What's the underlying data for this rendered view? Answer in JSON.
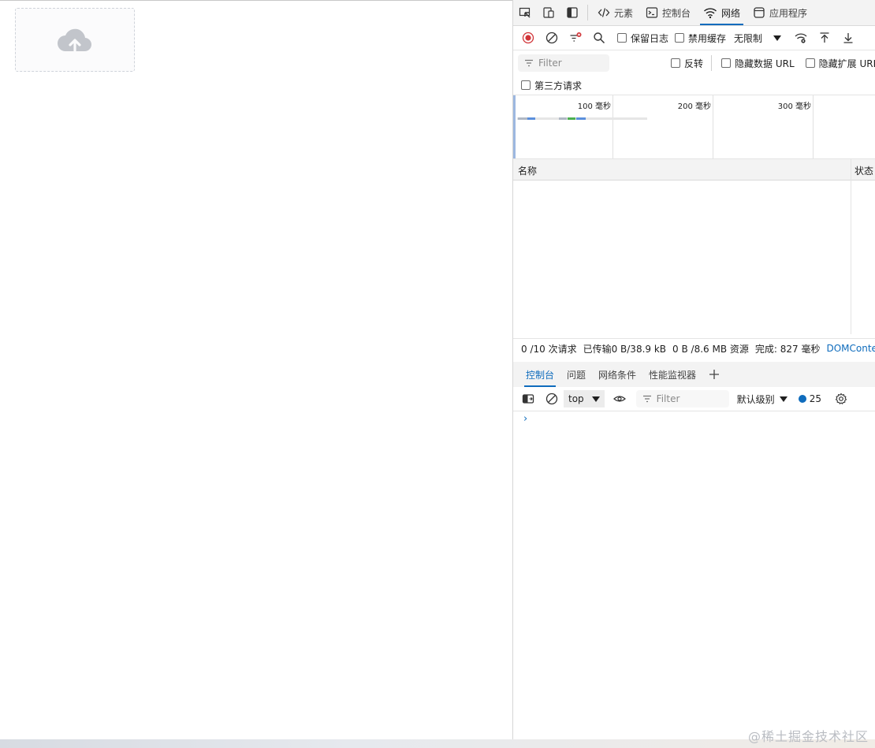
{
  "devtools": {
    "tabs": [
      {
        "label": "元素",
        "icon": "code-icon"
      },
      {
        "label": "控制台",
        "icon": "console-icon"
      },
      {
        "label": "网络",
        "icon": "wifi-icon",
        "active": true
      },
      {
        "label": "应用程序",
        "icon": "app-icon"
      }
    ],
    "toolbar": {
      "preserve_log": "保留日志",
      "disable_cache": "禁用缓存",
      "throttling": "无限制"
    },
    "filter": {
      "placeholder": "Filter",
      "invert": "反转",
      "hide_data_url": "隐藏数据 URL",
      "hide_ext_url": "隐藏扩展 URL",
      "third_party": "第三方请求"
    },
    "overview": {
      "ticks": [
        "100 毫秒",
        "200 毫秒",
        "300 毫秒"
      ]
    },
    "table": {
      "col_name": "名称",
      "col_status": "状态"
    },
    "summary": {
      "requests": "0 /10 次请求",
      "transferred": "已传输0 B/38.9 kB",
      "resources": "0 B /8.6 MB 资源",
      "finish": "完成: 827 毫秒",
      "dcl": "DOMContentLoaded"
    },
    "drawer": {
      "tabs": [
        "控制台",
        "问题",
        "网络条件",
        "性能监视器"
      ],
      "context": "top",
      "filter_placeholder": "Filter",
      "level": "默认级别",
      "message_count": "25"
    }
  },
  "watermark": "@稀土掘金技术社区",
  "colors": {
    "accent": "#0f6cbd",
    "record": "#d13438"
  }
}
